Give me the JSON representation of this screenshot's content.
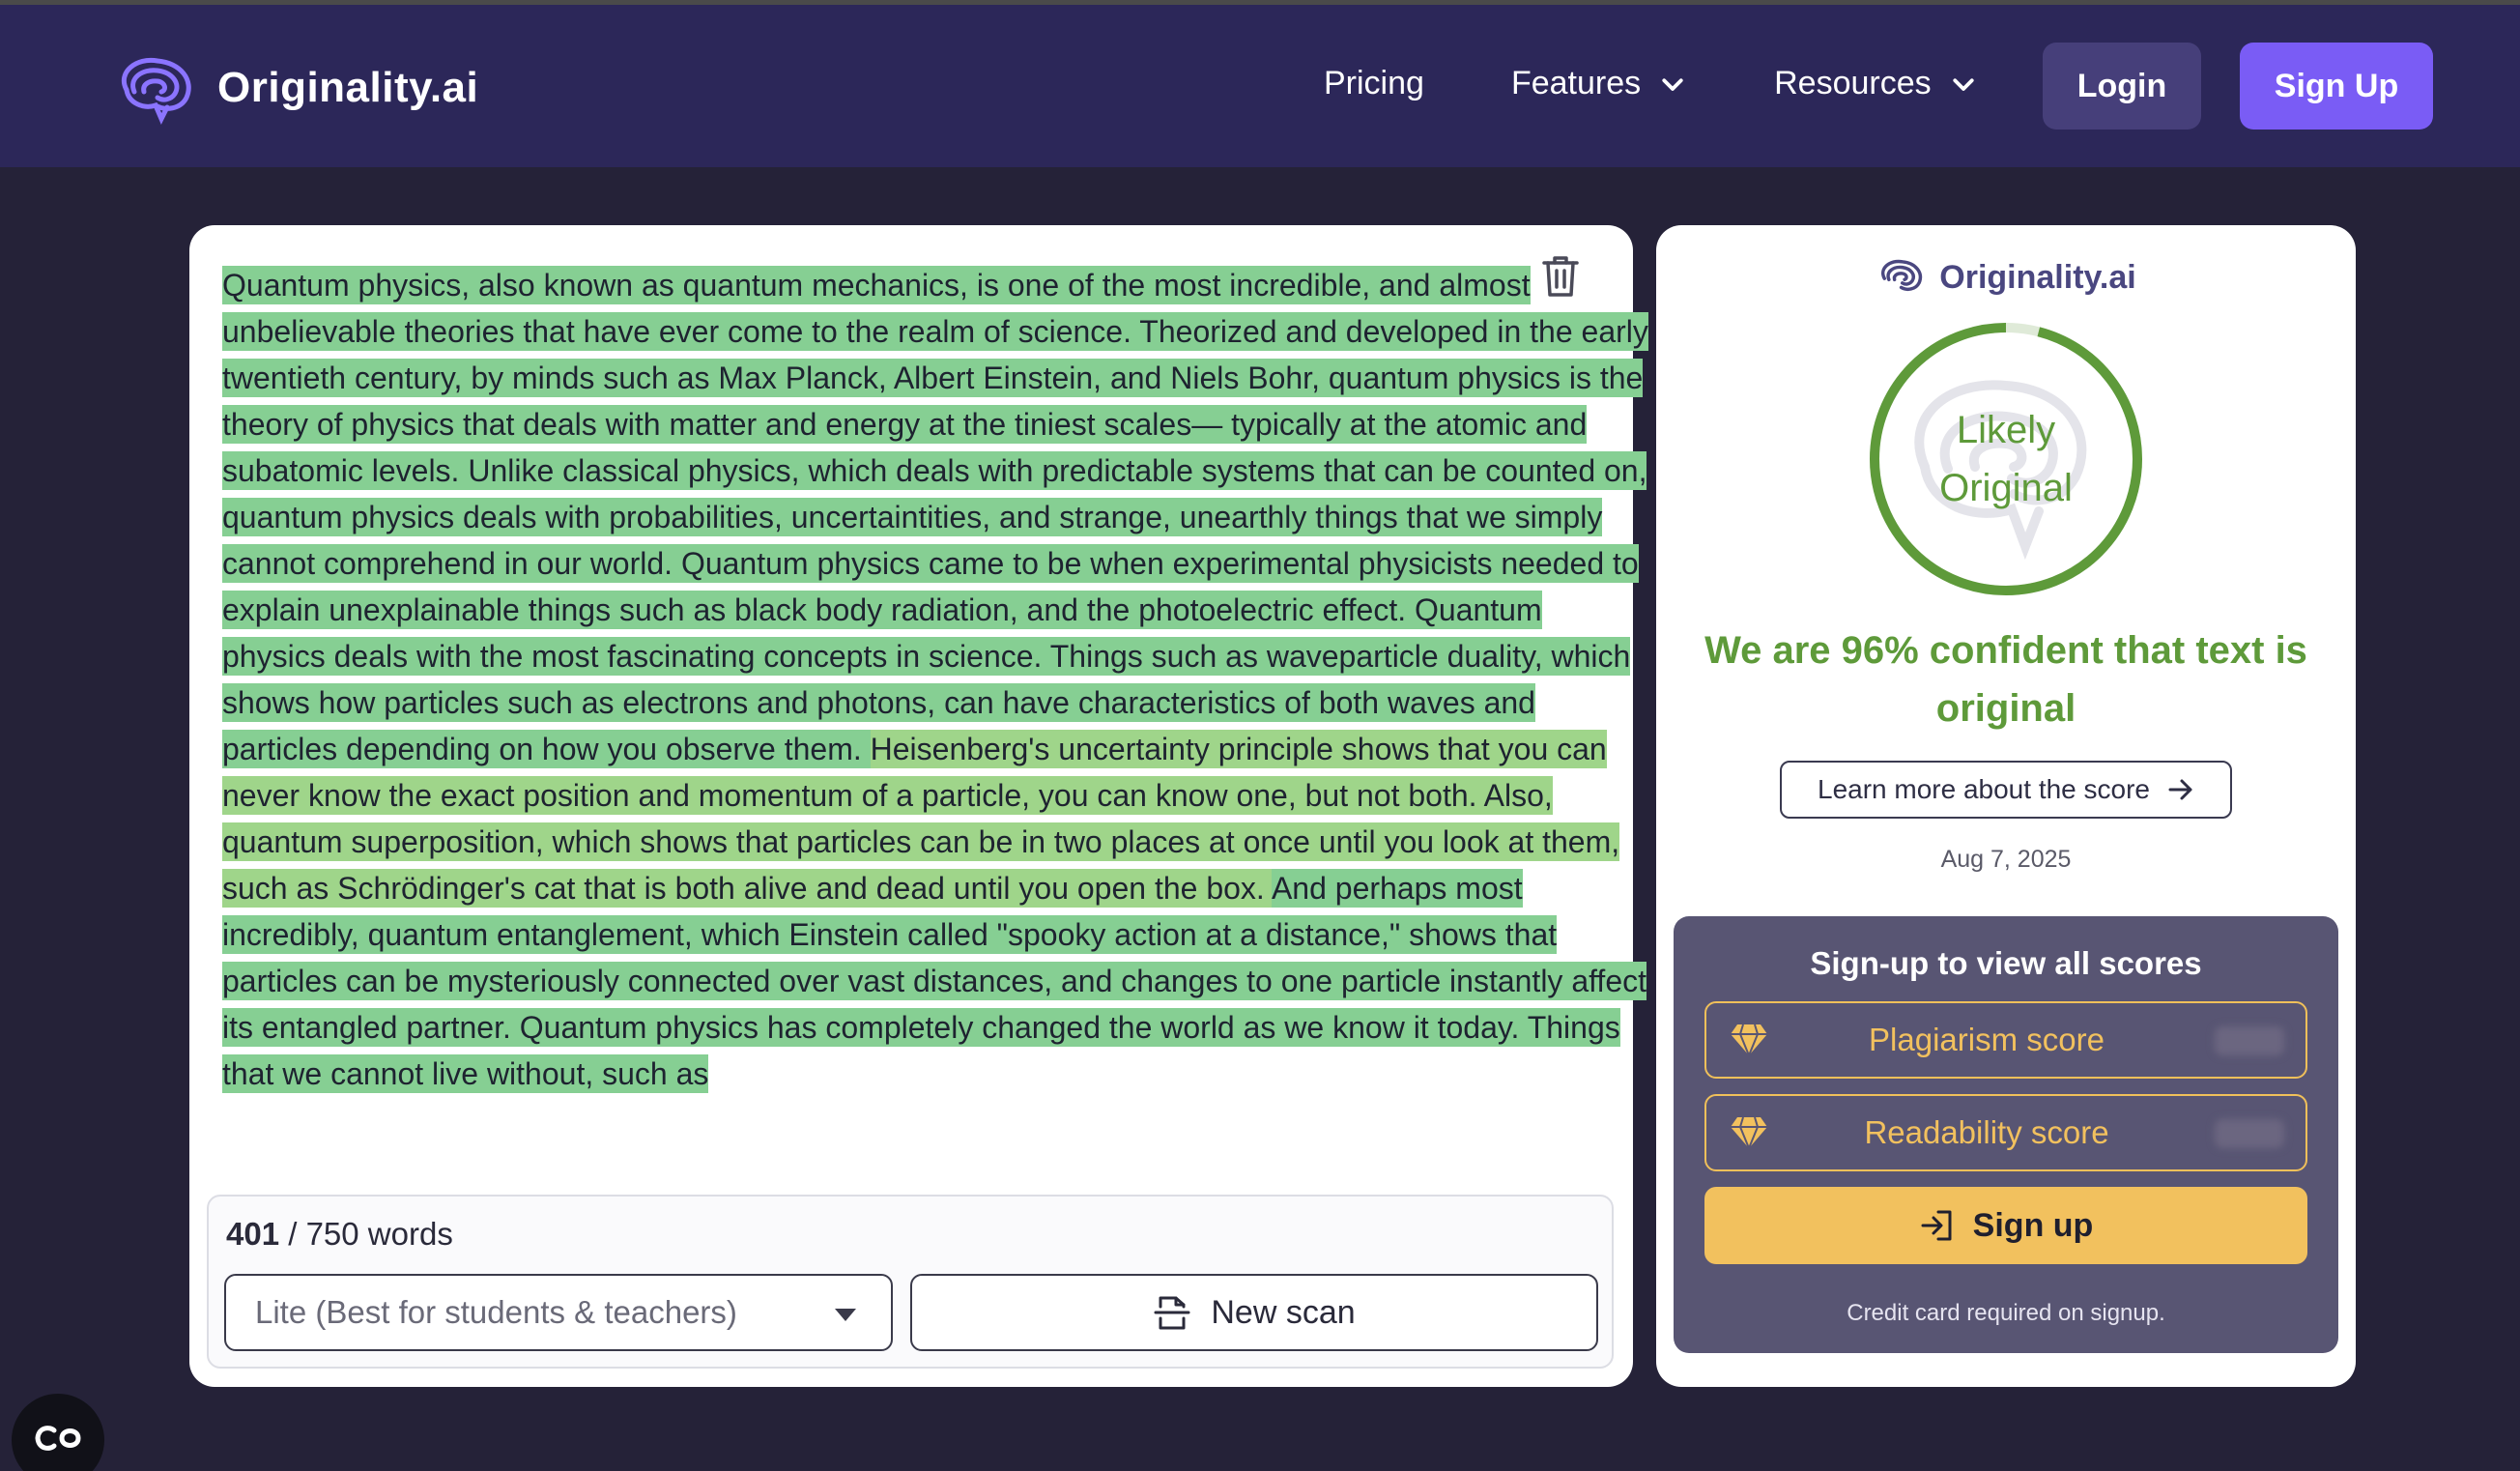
{
  "nav": {
    "brand": "Originality.ai",
    "links": [
      {
        "label": "Pricing",
        "dropdown": false
      },
      {
        "label": "Features",
        "dropdown": true
      },
      {
        "label": "Resources",
        "dropdown": true
      }
    ],
    "login_label": "Login",
    "signup_label": "Sign Up"
  },
  "editor": {
    "segments": [
      {
        "text": "Quantum physics, also known as quantum mechanics, is one of the most incredible, and almost unbelievable theories that have ever come to the realm of science. Theorized and developed in the early twentieth century, by minds such as Max Planck, Albert Einstein, and Niels Bohr, quantum physics is the theory of physics that deals with matter and energy at the tiniest scales— typically at the atomic and subatomic levels. Unlike classical physics, which deals with predictable systems that can be counted on, quantum physics deals with probabilities, uncertaintities, and strange, unearthly things that we simply cannot comprehend in our world. Quantum physics came to be when experimental physicists needed to explain unexplainable things such as black body radiation, and the photoelectric effect. Quantum physics deals with the most fascinating concepts in science. ",
        "tone": "hl1"
      },
      {
        "text": "Things such as waveparticle duality, which shows how particles such as electrons and photons, can have characteristics of both waves and particles depending on how you observe them. ",
        "tone": "hl1"
      },
      {
        "text": "Heisenberg's uncertainty principle shows that you can never know the exact position and momentum of a particle, you can know one, but not both. Also, quantum superposition, which shows that particles can be in two places at once until you look at them, such as Schrödinger's cat that is both alive and dead until you open the box. ",
        "tone": "hl2"
      },
      {
        "text": "And perhaps most incredibly, quantum entanglement, which Einstein called \"spooky action at a distance,\" shows that particles can be mysteriously connected over vast distances, and changes to one particle instantly affect its entangled partner. ",
        "tone": "hl1"
      },
      {
        "text": "Quantum physics has completely changed the world as we know it today. Things that we cannot live without, such as",
        "tone": "hl1"
      }
    ],
    "word_count": "401",
    "word_limit": "/ 750 words",
    "model_select": "Lite (Best for students & teachers)",
    "new_scan_label": "New scan"
  },
  "result": {
    "brand": "Originality.ai",
    "gauge_line1": "Likely",
    "gauge_line2": "Original",
    "gauge_fraction": 0.96,
    "confidence_text": "We are 96% confident that text is original",
    "learn_more_label": "Learn more about the score",
    "date": "Aug 7, 2025",
    "signup_panel": {
      "title": "Sign-up to view all scores",
      "plagiarism_label": "Plagiarism score",
      "readability_label": "Readability score",
      "signup_label": "Sign up",
      "credit_note": "Credit card required on signup."
    }
  },
  "colors": {
    "nav_bg": "#2c2759",
    "page_bg": "#252238",
    "accent_purple": "#7a5cf5",
    "highlight_green": "#86cf93",
    "score_green": "#5e9a3a",
    "gold": "#f2c15e"
  }
}
